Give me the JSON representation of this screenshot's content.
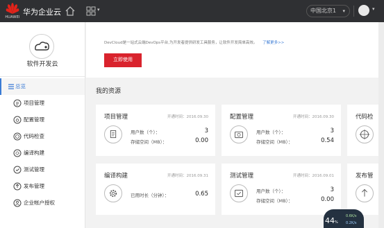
{
  "topbar": {
    "brand_text": "HUAWEI",
    "app_title": "华为企业云",
    "region": "中国北京1",
    "avatar_caret": "▾",
    "grid_caret": "▾"
  },
  "sidebar": {
    "service_name": "软件开发云",
    "items": [
      {
        "label": "总览",
        "icon": "menu-icon"
      },
      {
        "label": "项目管理",
        "icon": "list-icon"
      },
      {
        "label": "配置管理",
        "icon": "camera-icon"
      },
      {
        "label": "代码检查",
        "icon": "target-icon"
      },
      {
        "label": "编译构建",
        "icon": "gear-icon"
      },
      {
        "label": "测试管理",
        "icon": "test-icon"
      },
      {
        "label": "发布管理",
        "icon": "release-icon"
      },
      {
        "label": "企业帐户授权",
        "icon": "account-icon"
      }
    ]
  },
  "banner": {
    "text": "DevCloud是一站式云端DevOps平台,为开发者提供研发工具服务，让软件开发简单高效。",
    "link": "了解更多>>",
    "button": "立即使用"
  },
  "section_title": "我的资源",
  "cards": [
    {
      "title": "项目管理",
      "date": "开通时间：2016.09.30",
      "icon": "list-icon",
      "rows": [
        {
          "label": "用户数（个）：",
          "value": "3"
        },
        {
          "label": "存储空间（MB）：",
          "value": "0.00"
        }
      ]
    },
    {
      "title": "配置管理",
      "date": "开通时间：2016.09.30",
      "icon": "camera-icon",
      "rows": [
        {
          "label": "用户数（个）：",
          "value": "3"
        },
        {
          "label": "存储空间（MB）：",
          "value": "0.54"
        }
      ]
    },
    {
      "title": "代码检",
      "date": "",
      "icon": "target-icon",
      "rows": []
    },
    {
      "title": "编译构建",
      "date": "开通时间：2016.09.31",
      "icon": "gear-icon",
      "rows": [
        {
          "label": "已用时长（分钟）：",
          "value": "0.65"
        }
      ]
    },
    {
      "title": "测试管理",
      "date": "开通时间：2016.09.01",
      "icon": "test-icon",
      "rows": [
        {
          "label": "用户数（个）：",
          "value": "3"
        },
        {
          "label": "存储空间（MB）：",
          "value": "0.00"
        }
      ]
    },
    {
      "title": "发布管",
      "date": "",
      "icon": "release-icon",
      "rows": []
    }
  ],
  "gauge": {
    "value": "44",
    "unit": "%",
    "up": "0.6K/s",
    "down": "0.2K/s"
  },
  "colors": {
    "topbar": "#2f3033",
    "accent": "#3a7bd5",
    "brand_red": "#d9232d"
  }
}
